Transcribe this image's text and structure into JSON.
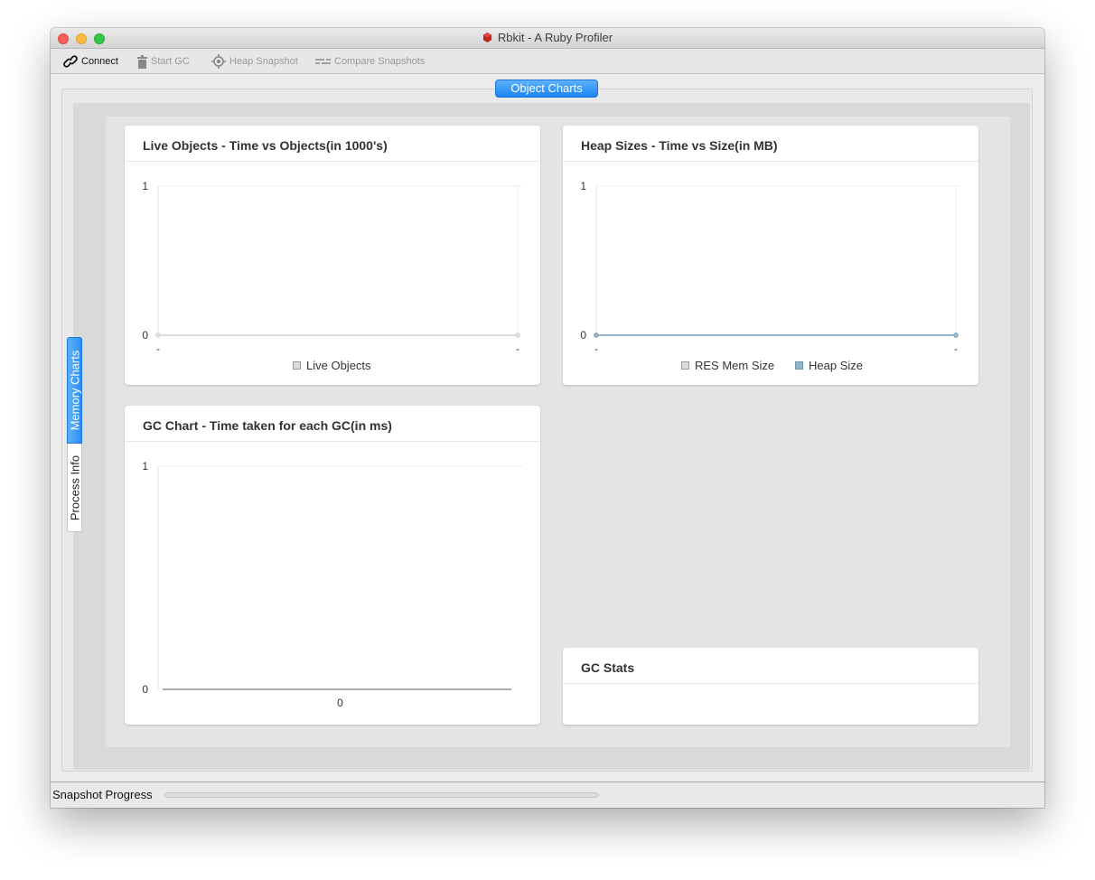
{
  "window": {
    "title": "Rbkit - A Ruby Profiler"
  },
  "toolbar": {
    "connect": "Connect",
    "start_gc": "Start GC",
    "heap_snapshot": "Heap Snapshot",
    "compare_snapshots": "Compare  Snapshots"
  },
  "tabs": {
    "top": "Object Charts",
    "side": [
      "Memory Charts",
      "Process Info"
    ]
  },
  "cards": {
    "live_objects": {
      "title": "Live Objects - Time vs Objects(in 1000's)",
      "legend": [
        "Live Objects"
      ]
    },
    "heap_sizes": {
      "title": "Heap Sizes - Time vs Size(in MB)",
      "legend": [
        "RES Mem Size",
        "Heap Size"
      ]
    },
    "gc_chart": {
      "title": "GC Chart - Time taken for each GC(in ms)"
    },
    "gc_stats": {
      "title": "GC Stats"
    }
  },
  "chart_data": [
    {
      "type": "line",
      "title": "Live Objects - Time vs Objects(in 1000's)",
      "x": [
        "-",
        "-"
      ],
      "series": [
        {
          "name": "Live Objects",
          "values": [
            0,
            0
          ],
          "color": "#dddddd"
        }
      ],
      "ylim": [
        0,
        1
      ],
      "yticks": [
        "1",
        "0"
      ]
    },
    {
      "type": "line",
      "title": "Heap Sizes - Time vs Size(in MB)",
      "x": [
        "-",
        "-"
      ],
      "series": [
        {
          "name": "RES Mem Size",
          "values": [
            0,
            0
          ],
          "color": "#dddddd"
        },
        {
          "name": "Heap Size",
          "values": [
            0,
            0
          ],
          "color": "#97b5c8"
        }
      ],
      "ylim": [
        0,
        1
      ],
      "yticks": [
        "1",
        "0"
      ]
    },
    {
      "type": "bar",
      "title": "GC Chart - Time taken for each GC(in ms)",
      "categories": [
        "0"
      ],
      "values": [
        0
      ],
      "ylim": [
        0,
        1
      ],
      "yticks": [
        "1",
        "0"
      ]
    }
  ],
  "status": {
    "label": "Snapshot Progress",
    "progress": 0
  },
  "colors": {
    "accent": "#2b8ff6",
    "heap_size": "#97b5c8",
    "res_mem": "#dddddd"
  }
}
